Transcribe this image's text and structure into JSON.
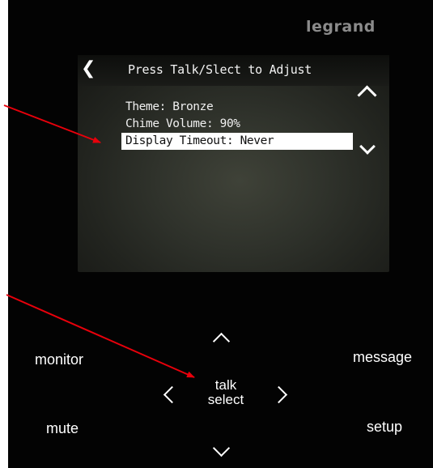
{
  "brand": "legrand",
  "screen": {
    "title": "Press Talk/Slect to Adjust",
    "back_icon": "chevron-left-icon",
    "items": [
      {
        "label": "Theme: Bronze",
        "selected": false
      },
      {
        "label": "Chime Volume: 90%",
        "selected": false
      },
      {
        "label": "Display Timeout: Never",
        "selected": true
      }
    ],
    "scroll_up_icon": "chevron-up-icon",
    "scroll_down_icon": "chevron-down-icon"
  },
  "keypad": {
    "monitor": "monitor",
    "message": "message",
    "mute": "mute",
    "setup": "setup",
    "center_line1": "talk",
    "center_line2": "select"
  },
  "colors": {
    "device_body": "#030303",
    "brand_text": "#8b8b8b",
    "annotation_arrow": "#e8000b",
    "selection_highlight": "#ffffff"
  }
}
